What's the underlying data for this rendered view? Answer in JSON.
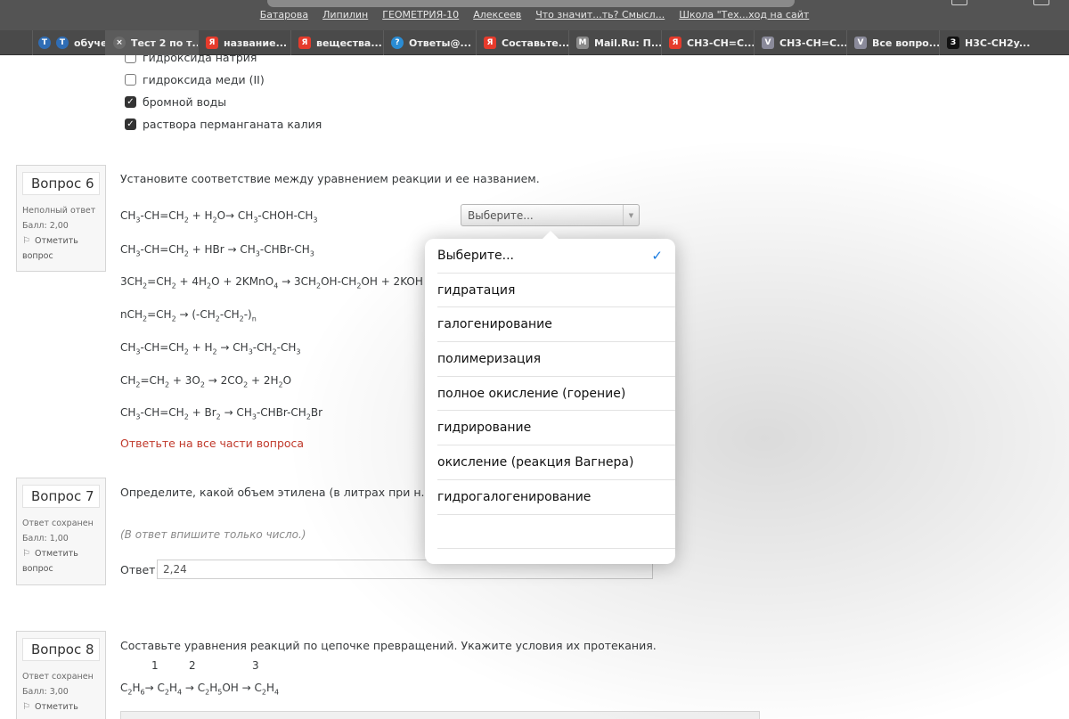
{
  "browser": {
    "bookmarks": [
      "Батарова",
      "Липилин",
      "ГЕОМЕТРИЯ-10",
      "Алексеев",
      "Что значит...ть? Смысл...",
      "Школа \"Тех...ход на сайт"
    ],
    "tabs": [
      {
        "label": "обучен",
        "icon": "T",
        "color": "#2f6db5"
      },
      {
        "label": "Тест 2 по т...",
        "icon": "×",
        "color": "#6b6b6b"
      },
      {
        "label": "название...",
        "icon": "Я",
        "color": "#e53b2c"
      },
      {
        "label": "вещества...",
        "icon": "Я",
        "color": "#e53b2c"
      },
      {
        "label": "Ответы@...",
        "icon": "?",
        "color": "#2a8cd4"
      },
      {
        "label": "Составьте...",
        "icon": "Я",
        "color": "#e53b2c"
      },
      {
        "label": "Mail.Ru: П...",
        "icon": "M",
        "color": "#8a8a8a"
      },
      {
        "label": "CH3-CH=C...",
        "icon": "Я",
        "color": "#e53b2c"
      },
      {
        "label": "CH3-CH=C...",
        "icon": "V",
        "color": "#8a8a9a"
      },
      {
        "label": "Все вопро...",
        "icon": "V",
        "color": "#8a8a9a"
      },
      {
        "label": "H3C-CH2y...",
        "icon": "З",
        "color": "#111111"
      }
    ]
  },
  "q5": {
    "options": [
      {
        "label": "гидроксида натрия",
        "checked": false
      },
      {
        "label": "гидроксида меди (II)",
        "checked": false
      },
      {
        "label": "бромной воды",
        "checked": true
      },
      {
        "label": "раствора перманганата калия",
        "checked": true
      }
    ]
  },
  "q6": {
    "title": "Вопрос 6",
    "status": "Неполный ответ",
    "score": "Балл: 2,00",
    "flag": "Отметить вопрос",
    "text": "Установите соответствие между уравнением реакции и ее названием.",
    "select_value": "Выберите...",
    "warning": "Ответьте на все части вопроса"
  },
  "q7": {
    "title": "Вопрос 7",
    "status": "Ответ сохранен",
    "score": "Балл: 1,00",
    "flag": "Отметить вопрос",
    "text": "Определите, какой объем  этилена (в литрах при н.у.)  об",
    "hint": "(В ответ впишите только число.)",
    "answer_label": "Ответ:",
    "answer_value": "2,24"
  },
  "q8": {
    "title": "Вопрос 8",
    "status": "Ответ сохранен",
    "score": "Балл: 3,00",
    "flag": "Отметить",
    "text": "Составьте уравнения реакций по цепочке превращений. Укажите условия их протекания.",
    "step_numbers": [
      "1",
      "2",
      "3"
    ]
  },
  "dropdown": {
    "options": [
      {
        "label": "Выберите...",
        "selected": true
      },
      {
        "label": "гидратация",
        "selected": false
      },
      {
        "label": "галогенирование",
        "selected": false
      },
      {
        "label": "полимеризация",
        "selected": false
      },
      {
        "label": "полное окисление (горение)",
        "selected": false
      },
      {
        "label": "гидрирование",
        "selected": false
      },
      {
        "label": "окисление (реакция Вагнера)",
        "selected": false
      },
      {
        "label": "гидрогалогенирование",
        "selected": false
      }
    ],
    "accent": "#1a7ce0"
  }
}
